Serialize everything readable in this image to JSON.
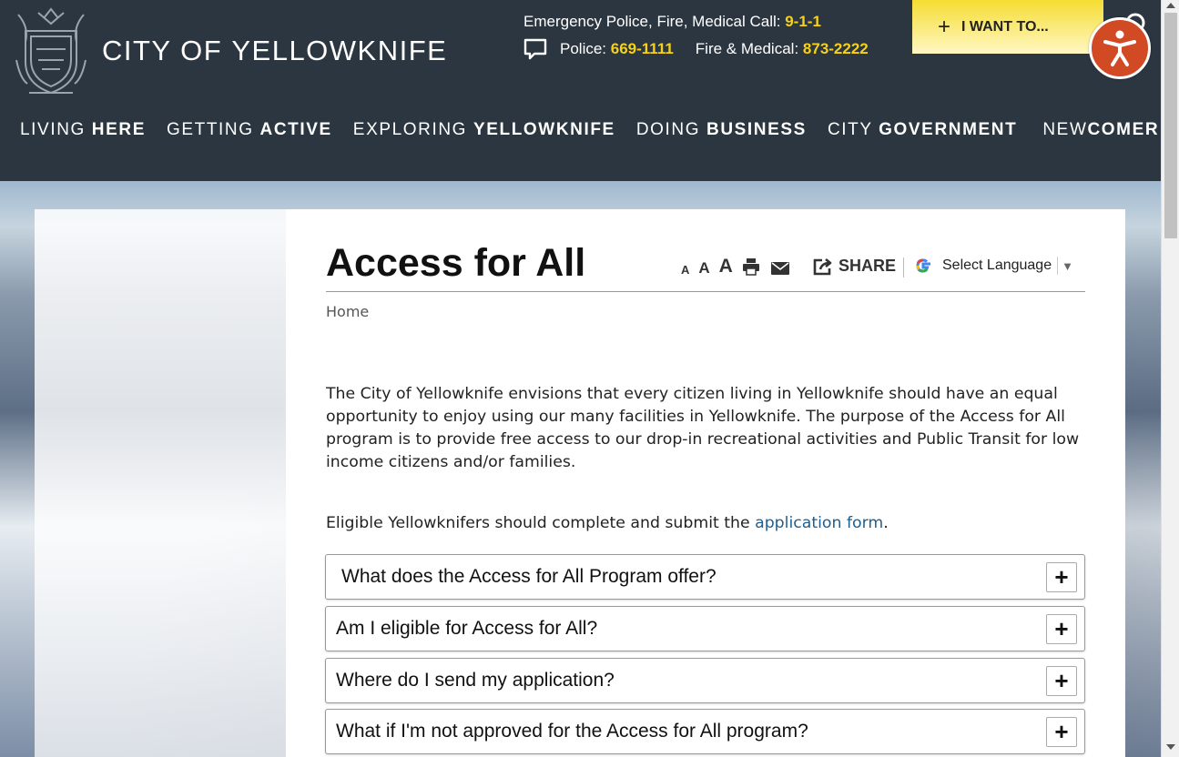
{
  "header": {
    "city_light": "CITY OF",
    "city_bold": "YELLOWKNIFE",
    "emergency_label": "Emergency Police, Fire, Medical Call:",
    "emergency_number": "9-1-1",
    "police_label": "Police:",
    "police_number": "669-1111",
    "fire_label": "Fire & Medical:",
    "fire_number": "873-2222",
    "i_want_label": "I WANT TO...",
    "accent_color": "#f7d117",
    "bg_color": "#2b3640"
  },
  "nav": [
    {
      "light": "LIVING ",
      "bold": "HERE"
    },
    {
      "light": "GETTING ",
      "bold": "ACTIVE"
    },
    {
      "light": "EXPLORING ",
      "bold": "YELLOWKNIFE"
    },
    {
      "light": "DOING ",
      "bold": "BUSINESS"
    },
    {
      "light": "CITY ",
      "bold": "GOVERNMENT"
    },
    {
      "light": "NEW",
      "bold": "COMER"
    }
  ],
  "page": {
    "title": "Access for All",
    "share_label": "SHARE",
    "language_label": "Select Language",
    "breadcrumb_home": "Home",
    "intro": "The City of Yellowknife envisions that every citizen living in Yellowknife should have an equal opportunity to enjoy using our many facilities in Yellowknife. The purpose of the Access for All program is to provide free access to our drop-in recreational activities and Public Transit for low income citizens and/or families.",
    "eligible_text": "Eligible Yellowknifers should complete and submit the ",
    "eligible_link": "application form",
    "eligible_end": "."
  },
  "accordion": [
    {
      "question": "What does the Access for All Program offer?",
      "toggle": "+"
    },
    {
      "question": "Am I eligible for Access for All?",
      "toggle": "+"
    },
    {
      "question": "Where do I send my application?",
      "toggle": "+"
    },
    {
      "question": "What if I'm not approved for the Access for All program?",
      "toggle": "+"
    }
  ],
  "icons": [
    "city-crest-icon",
    "chat-icon",
    "plus-icon",
    "search-icon",
    "accessibility-icon",
    "print-icon",
    "email-icon",
    "share-icon",
    "google-icon"
  ]
}
